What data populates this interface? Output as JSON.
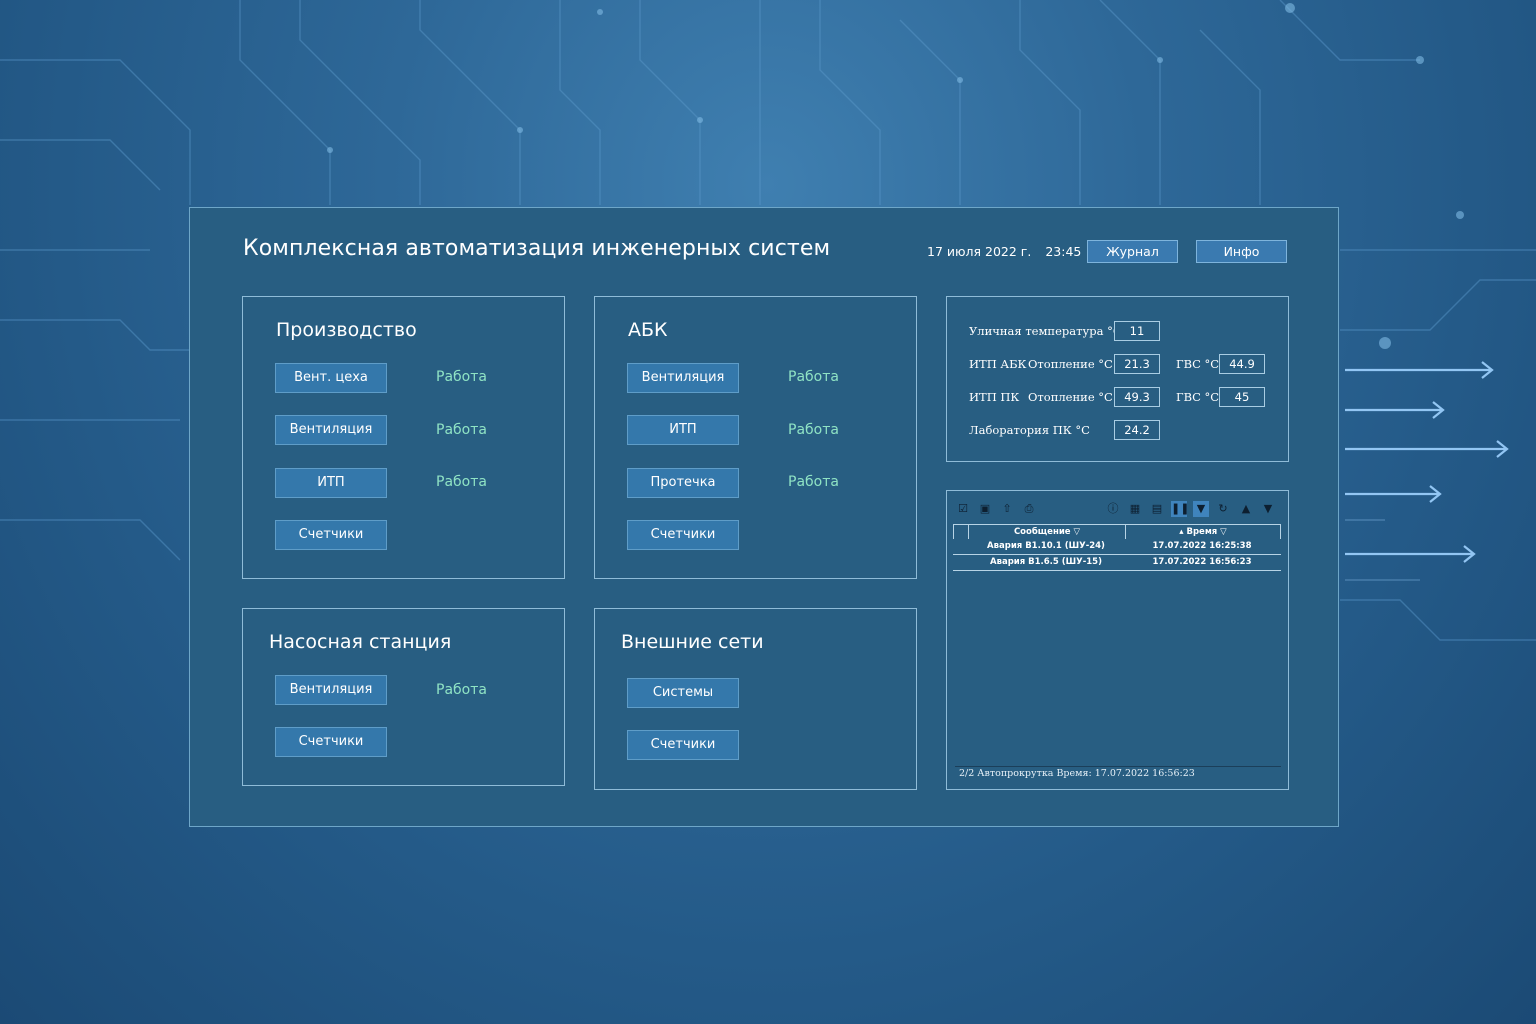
{
  "header": {
    "title": "Комплексная автоматизация инженерных систем",
    "date": "17 июля 2022 г.",
    "time": "23:45",
    "journal_button": "Журнал",
    "info_button": "Инфо"
  },
  "sections": {
    "production": {
      "title": "Производство",
      "items": [
        {
          "label": "Вент. цеха",
          "status": "Работа"
        },
        {
          "label": "Вентиляция",
          "status": "Работа"
        },
        {
          "label": "ИТП",
          "status": "Работа"
        },
        {
          "label": "Счетчики",
          "status": ""
        }
      ]
    },
    "abk": {
      "title": "АБК",
      "items": [
        {
          "label": "Вентиляция",
          "status": "Работа"
        },
        {
          "label": "ИТП",
          "status": "Работа"
        },
        {
          "label": "Протечка",
          "status": "Работа"
        },
        {
          "label": "Счетчики",
          "status": ""
        }
      ]
    },
    "pump": {
      "title": "Насосная станция",
      "items": [
        {
          "label": "Вентиляция",
          "status": "Работа"
        },
        {
          "label": "Счетчики",
          "status": ""
        }
      ]
    },
    "external": {
      "title": "Внешние сети",
      "items": [
        {
          "label": "Системы",
          "status": ""
        },
        {
          "label": "Счетчики",
          "status": ""
        }
      ]
    }
  },
  "readings": {
    "outdoor_label": "Уличная температура °C",
    "outdoor_value": "11",
    "itp_abk_label": "ИТП АБК",
    "itp_pk_label": "ИТП ПК",
    "heating_label": "Отопление °C",
    "gvs_label": "ГВС °C",
    "itp_abk_heating": "21.3",
    "itp_abk_gvs": "44.9",
    "itp_pk_heating": "49.3",
    "itp_pk_gvs": "45",
    "lab_label": "Лаборатория ПК °C",
    "lab_value": "24.2"
  },
  "alarms": {
    "columns": {
      "message": "Сообщение ▽",
      "time": "▴ Время ▽"
    },
    "rows": [
      {
        "message": "Авария B1.10.1 (ШУ-24)",
        "time": "17.07.2022 16:25:38"
      },
      {
        "message": "Авария B1.6.5 (ШУ-15)",
        "time": "17.07.2022 16:56:23"
      }
    ],
    "footer": "2/2 Автопрокрутка Время: 17.07.2022 16:56:23",
    "toolbar_icons": [
      "acknowledge-icon",
      "acknowledge-all-icon",
      "export-icon",
      "print-icon",
      "info-icon",
      "calendar-icon",
      "report-icon",
      "pause-icon",
      "filter-icon",
      "refresh-icon",
      "scroll-up-icon",
      "scroll-down-icon"
    ]
  },
  "colors": {
    "panel": "#285e82",
    "button": "#3478ab",
    "status_ok": "#8fe3c4",
    "border": "#8fbcd8"
  }
}
